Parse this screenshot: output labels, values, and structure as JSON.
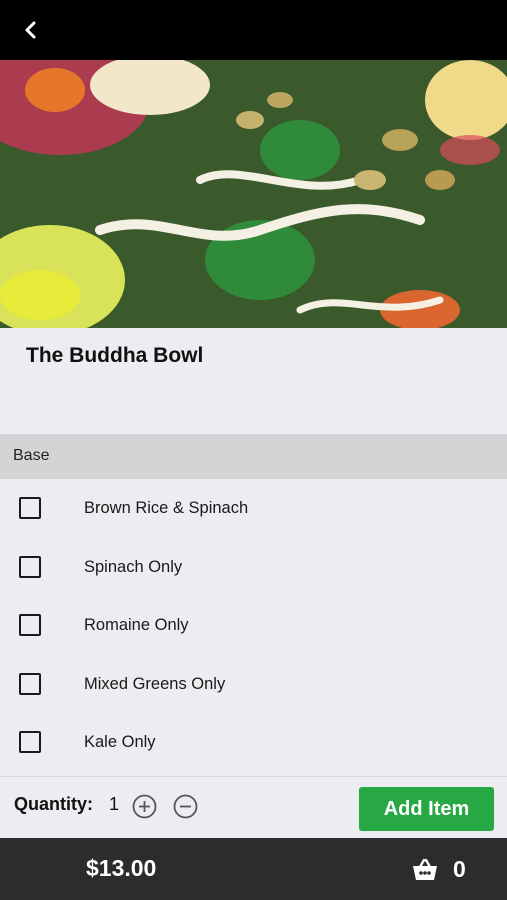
{
  "header": {
    "back_icon": "chevron-left-icon"
  },
  "hero": {
    "image": "salad-bowl-photo"
  },
  "item": {
    "title": "The Buddha Bowl"
  },
  "section": {
    "title": "Base"
  },
  "options": [
    {
      "label": "Brown Rice & Spinach",
      "checked": false
    },
    {
      "label": "Spinach Only",
      "checked": false
    },
    {
      "label": "Romaine Only",
      "checked": false
    },
    {
      "label": "Mixed Greens Only",
      "checked": false
    },
    {
      "label": "Kale Only",
      "checked": false
    }
  ],
  "quantity": {
    "label": "Quantity:",
    "value": "1",
    "plus_icon": "plus-circle-icon",
    "minus_icon": "minus-circle-icon"
  },
  "actions": {
    "add_label": "Add Item",
    "add_color": "#27a844"
  },
  "footer": {
    "total": "$13.00",
    "cart_icon": "basket-icon",
    "cart_count": "0"
  }
}
